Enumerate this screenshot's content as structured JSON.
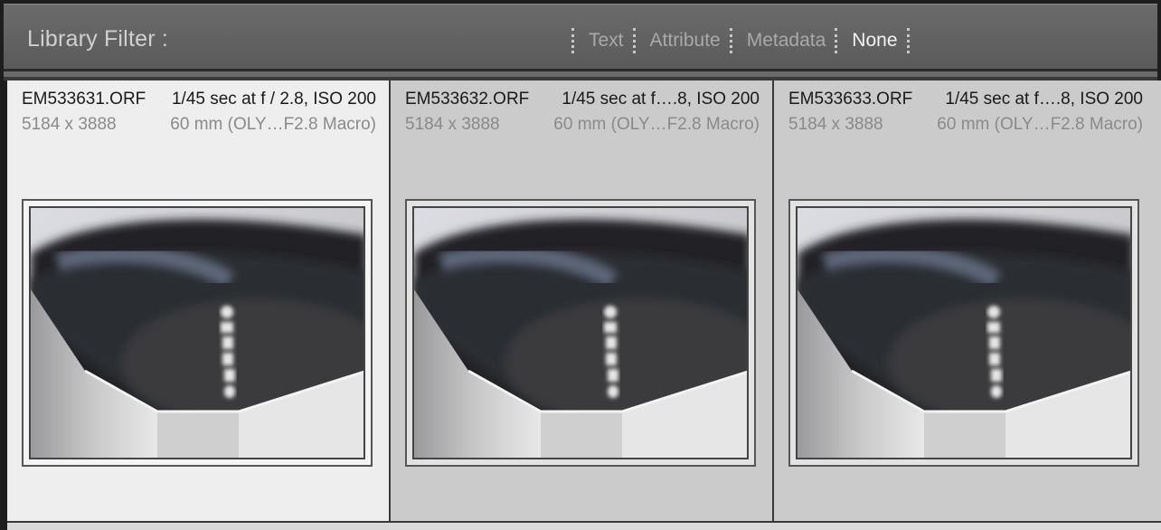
{
  "filter_bar": {
    "title": "Library Filter :",
    "tabs": [
      {
        "label": "Text",
        "active": false
      },
      {
        "label": "Attribute",
        "active": false
      },
      {
        "label": "Metadata",
        "active": false
      },
      {
        "label": "None",
        "active": true
      }
    ]
  },
  "photos": [
    {
      "filename": "EM533631.ORF",
      "exposure": "1/45 sec at f / 2.8, ISO 200",
      "dimensions": "5184 x 3888",
      "lens": "60 mm (OLY…F2.8 Macro)",
      "selected": true
    },
    {
      "filename": "EM533632.ORF",
      "exposure": "1/45 sec at f….8, ISO 200",
      "dimensions": "5184 x 3888",
      "lens": "60 mm (OLY…F2.8 Macro)",
      "selected": false
    },
    {
      "filename": "EM533633.ORF",
      "exposure": "1/45 sec at f….8, ISO 200",
      "dimensions": "5184 x 3888",
      "lens": "60 mm (OLY…F2.8 Macro)",
      "selected": false
    }
  ],
  "colors": {
    "selected_cell": "#eeeeee",
    "cell": "#cbcbcb",
    "active_tab": "#f2f2f2",
    "inactive_tab": "#a9a9a9"
  }
}
